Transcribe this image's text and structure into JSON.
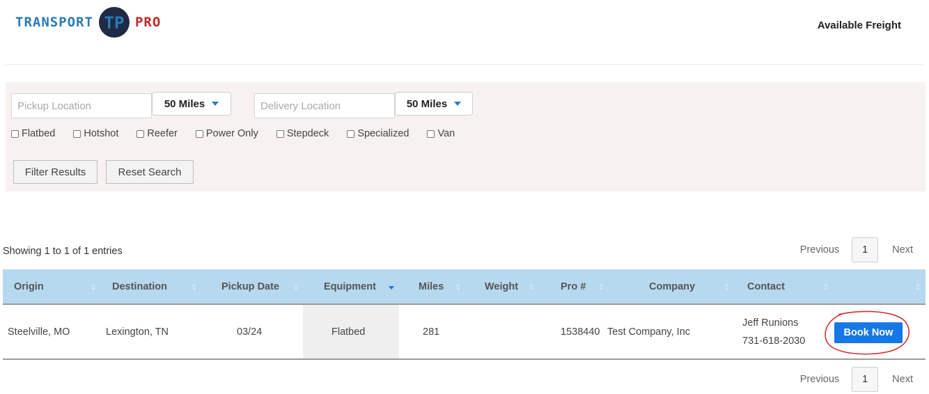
{
  "header": {
    "logo_left": "TRANSPORT",
    "logo_mark": "TP",
    "logo_right": "PRO",
    "nav_link": "Available Freight"
  },
  "filters": {
    "pickup_placeholder": "Pickup Location",
    "pickup_value": "",
    "pickup_radius": "50 Miles",
    "delivery_placeholder": "Delivery Location",
    "delivery_value": "",
    "delivery_radius": "50 Miles",
    "equipment_types": [
      "Flatbed",
      "Hotshot",
      "Reefer",
      "Power Only",
      "Stepdeck",
      "Specialized",
      "Van"
    ],
    "filter_button": "Filter Results",
    "reset_button": "Reset Search"
  },
  "entries_info": "Showing 1 to 1 of 1 entries",
  "pagination": {
    "previous": "Previous",
    "page": "1",
    "next": "Next"
  },
  "table": {
    "columns": [
      "Origin",
      "Destination",
      "Pickup Date",
      "Equipment",
      "Miles",
      "Weight",
      "Pro #",
      "Company",
      "Contact",
      ""
    ],
    "rows": [
      {
        "origin": "Steelville, MO",
        "destination": "Lexington, TN",
        "pickup_date": "03/24",
        "equipment": "Flatbed",
        "miles": "281",
        "weight": "",
        "pro": "1538440",
        "company": "Test Company, Inc",
        "contact_name": "Jeff Runions",
        "contact_phone": "731-618-2030",
        "action": "Book Now"
      }
    ]
  },
  "colors": {
    "header_row": "#b6d9ef",
    "book_button": "#1677e6",
    "annotation_circle": "#d32f2f",
    "logo_blue": "#2a7bb6",
    "logo_red": "#c62828"
  }
}
